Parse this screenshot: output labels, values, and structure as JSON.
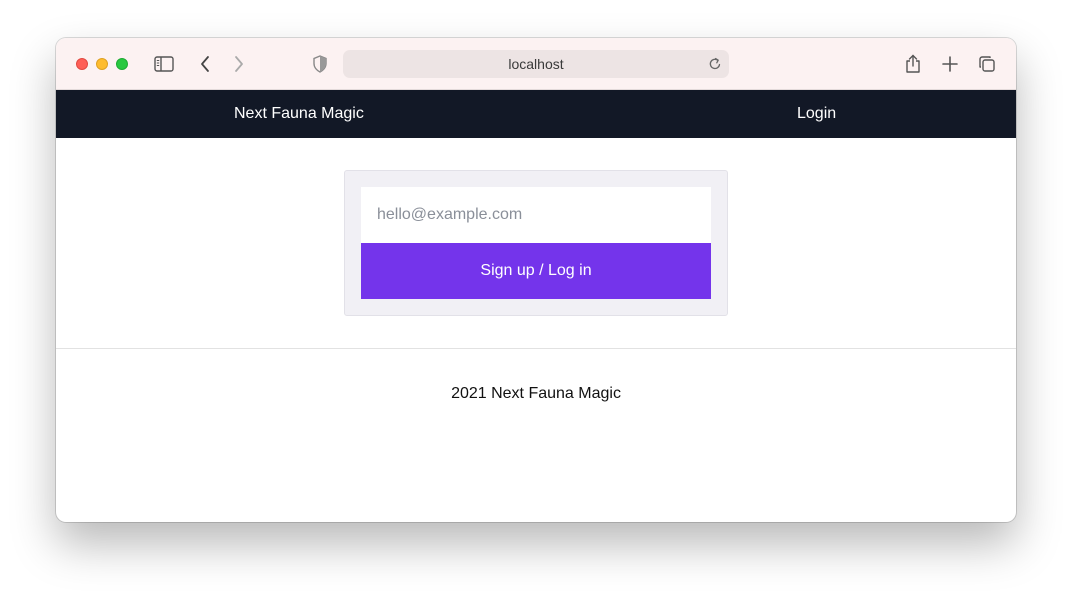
{
  "browser": {
    "url": "localhost"
  },
  "navbar": {
    "brand": "Next Fauna Magic",
    "login_label": "Login"
  },
  "login_form": {
    "email_placeholder": "hello@example.com",
    "email_value": "",
    "submit_label": "Sign up / Log in"
  },
  "footer": {
    "text": "2021 Next Fauna Magic"
  },
  "colors": {
    "navbar_bg": "#121826",
    "button_bg": "#7434eb",
    "card_bg": "#f1f0f5",
    "titlebar_bg": "#fcf2f2"
  }
}
